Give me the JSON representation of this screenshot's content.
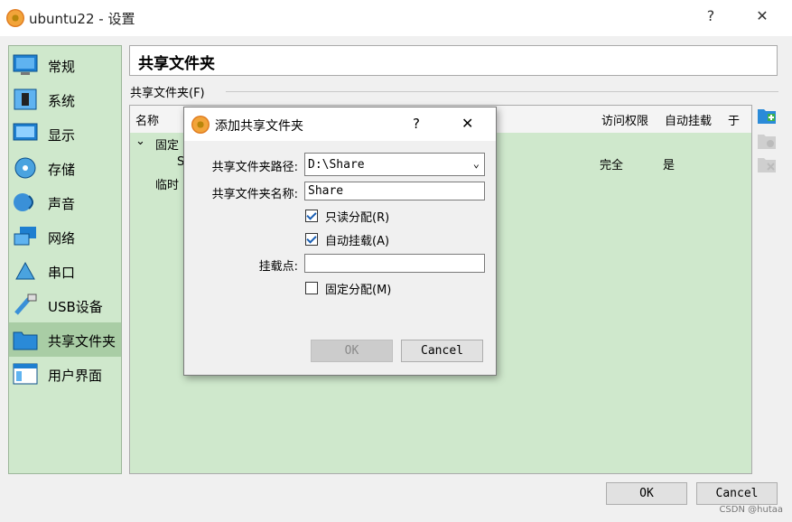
{
  "window": {
    "title": "ubuntu22 - 设置",
    "help_button": "?",
    "close_button": "✕"
  },
  "sidebar": {
    "items": [
      {
        "label": "常规",
        "icon": "general-icon"
      },
      {
        "label": "系统",
        "icon": "system-icon"
      },
      {
        "label": "显示",
        "icon": "display-icon"
      },
      {
        "label": "存储",
        "icon": "storage-icon"
      },
      {
        "label": "声音",
        "icon": "audio-icon"
      },
      {
        "label": "网络",
        "icon": "network-icon"
      },
      {
        "label": "串口",
        "icon": "serial-port-icon"
      },
      {
        "label": "USB设备",
        "icon": "usb-icon"
      },
      {
        "label": "共享文件夹",
        "icon": "shared-folder-icon"
      },
      {
        "label": "用户界面",
        "icon": "user-interface-icon"
      }
    ],
    "selected": "共享文件夹"
  },
  "main": {
    "header": "共享文件夹",
    "group_label": "共享文件夹(F)",
    "columns": [
      "名称",
      "访问权限",
      "自动挂载",
      "于"
    ],
    "rows": {
      "fixed_group": "固定",
      "row1_name_partial": "S",
      "row1_access": "完全",
      "row1_automount": "是",
      "temp_group": "临时"
    }
  },
  "dialog": {
    "title": "添加共享文件夹",
    "help_button": "?",
    "close_button": "✕",
    "path_label": "共享文件夹路径:",
    "path_value": "D:\\Share",
    "name_label": "共享文件夹名称:",
    "name_value": "Share",
    "readonly_label": "只读分配(R)",
    "readonly_checked": true,
    "automount_label": "自动挂载(A)",
    "automount_checked": true,
    "mountpoint_label": "挂载点:",
    "mountpoint_value": "",
    "permanent_label": "固定分配(M)",
    "permanent_checked": false,
    "ok_button": "OK",
    "cancel_button": "Cancel"
  },
  "footer": {
    "ok_button": "OK",
    "cancel_button": "Cancel",
    "watermark": "CSDN @hutaa"
  }
}
